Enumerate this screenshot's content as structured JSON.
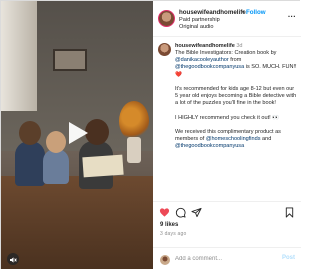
{
  "header": {
    "username": "housewifeandhomelife",
    "separator": "•",
    "follow_label": "Follow",
    "line1": "Paid partnership",
    "line2": "Original audio",
    "more_label": "..."
  },
  "caption": {
    "username": "housewifeandhomelife",
    "time": "3d",
    "line1_pre": "The Bible Investigators: Creation book by ",
    "mention1": "@danikacooleyauthor",
    "line1_mid": " from ",
    "mention2": "@thegoodbookcompanyusa",
    "line1_post": " is SO. MUCH. FUN!! ❤️",
    "para2": "It's recommended for kids age 8-12 but even our 5 year old enjoys becoming a Bible detective with a lot of the puzzles you'll fine in the book!",
    "para3": "I HIGHLY recommend you check it out! 👀",
    "para4_pre": "We received this complimentary product as members of ",
    "mention3": "@homeschoolingfinds",
    "para4_mid": " and ",
    "mention4": "@thegoodbookcompanyusa"
  },
  "actions": {
    "likes": "9 likes",
    "ago": "3 days ago"
  },
  "comment": {
    "placeholder": "Add a comment...",
    "post_label": "Post"
  },
  "colors": {
    "accent": "#0095f6",
    "like": "#ed4956",
    "text": "#262626",
    "muted": "#8e8e8e"
  }
}
